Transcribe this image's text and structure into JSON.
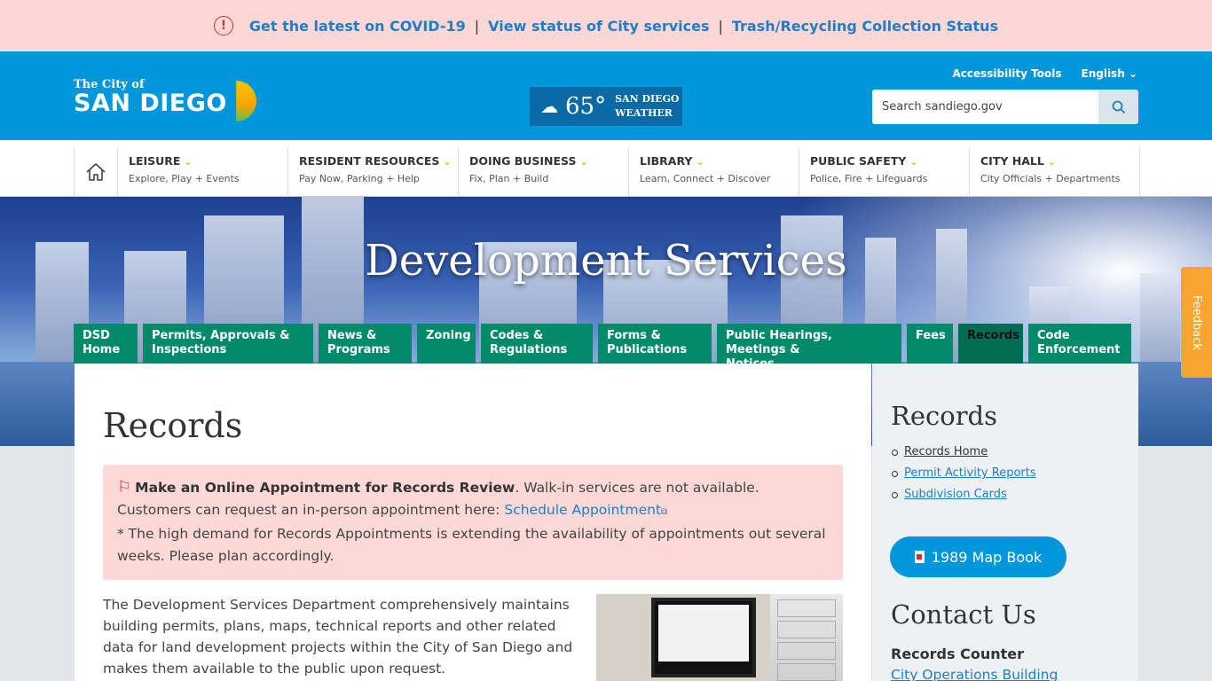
{
  "alert": {
    "links": [
      "Get the latest on COVID-19",
      "View status of City services",
      "Trash/Recycling Collection Status"
    ],
    "separator": "|"
  },
  "header": {
    "logo_small": "The City of",
    "logo_big": "SAN DIEGO",
    "weather": {
      "temp": "65°",
      "label_line1": "SAN DIEGO",
      "label_line2": "WEATHER"
    },
    "accessibility_tools": "Accessibility Tools",
    "language": "English",
    "search_placeholder": "Search sandiego.gov"
  },
  "mainnav": {
    "items": [
      {
        "title": "LEISURE",
        "sub": "Explore, Play + Events"
      },
      {
        "title": "RESIDENT RESOURCES",
        "sub": "Pay Now, Parking + Help"
      },
      {
        "title": "DOING BUSINESS",
        "sub": "Fix, Plan + Build"
      },
      {
        "title": "LIBRARY",
        "sub": "Learn, Connect + Discover"
      },
      {
        "title": "PUBLIC SAFETY",
        "sub": "Police, Fire + Lifeguards"
      },
      {
        "title": "CITY HALL",
        "sub": "City Officials + Departments"
      }
    ]
  },
  "banner": {
    "title": "Development Services"
  },
  "subnav": {
    "items": [
      {
        "line1": "DSD",
        "line2": "Home"
      },
      {
        "line1": "Permits, Approvals &",
        "line2": "Inspections"
      },
      {
        "line1": "News &",
        "line2": "Programs"
      },
      {
        "line1": "Zoning",
        "line2": ""
      },
      {
        "line1": "Codes &",
        "line2": "Regulations"
      },
      {
        "line1": "Forms &",
        "line2": "Publications"
      },
      {
        "line1": "Public Hearings, Meetings &",
        "line2": "Notices"
      },
      {
        "line1": "Fees",
        "line2": ""
      },
      {
        "line1": "Records",
        "line2": ""
      },
      {
        "line1": "Code",
        "line2": "Enforcement"
      }
    ]
  },
  "feedback": "Feedback",
  "content": {
    "title": "Records",
    "notice": {
      "heading": "Make an Online Appointment for Records Review",
      "text1": ". Walk-in services are not available. Customers can request an in-person appointment here: ",
      "link": "Schedule Appointment",
      "text2": "* The high demand for Records Appointments is extending the availability of appointments out several weeks. Please plan accordingly."
    },
    "body": "The Development Services Department comprehensively maintains building permits, plans, maps, technical reports and other related data for land development projects within the City of San Diego and makes them available to the public upon request."
  },
  "sidebar": {
    "title": "Records",
    "links": [
      "Records Home",
      "Permit Activity Reports",
      "Subdivision Cards"
    ],
    "map_button": "1989 Map Book",
    "contact_title": "Contact Us",
    "counter_title": "Records Counter",
    "building_link": "City Operations Building"
  }
}
